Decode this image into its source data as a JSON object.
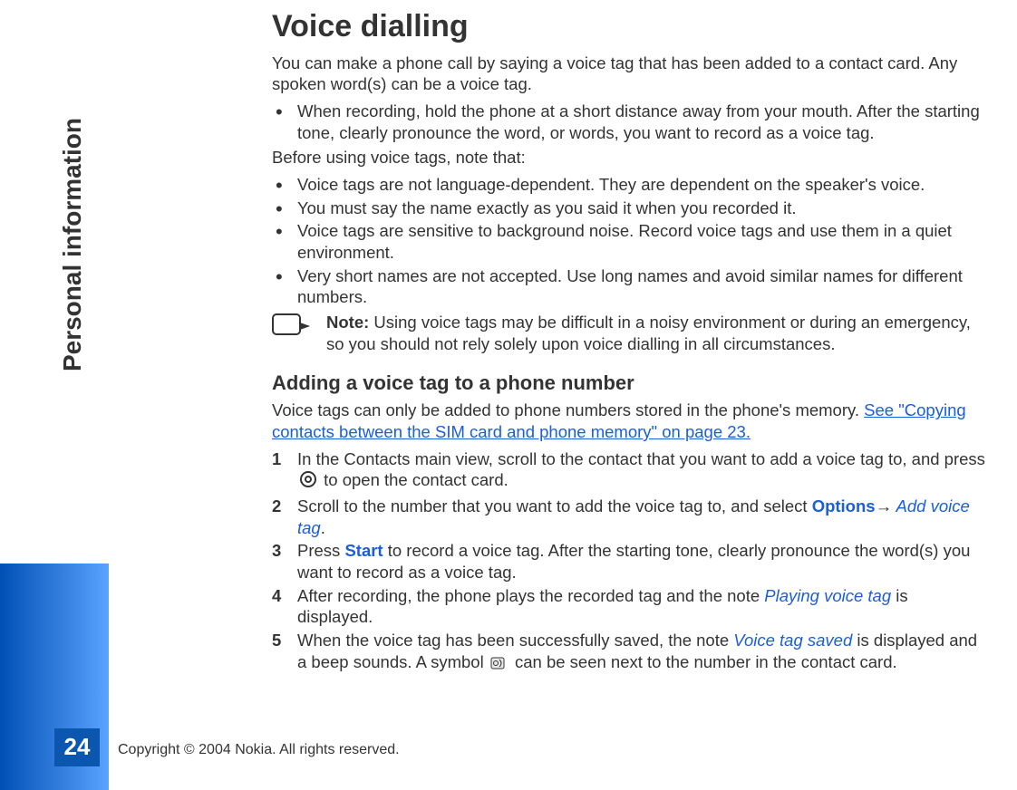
{
  "page": {
    "number": "24",
    "side_label": "Personal information",
    "footer": "Copyright © 2004 Nokia. All rights reserved."
  },
  "main": {
    "h1": "Voice dialling",
    "intro": "You can make a phone call by saying a voice tag that has been added to a contact card. Any spoken word(s) can be a voice tag.",
    "bullet_recording": "When recording, hold the phone at a short distance away from your mouth. After the starting tone, clearly pronounce the word, or words, you want to record as a voice tag.",
    "before_heading": "Before using voice tags, note that:",
    "bullets": [
      "Voice tags are not language-dependent. They are dependent on the speaker's voice.",
      "You must say the name exactly as you said it when you recorded it.",
      "Voice tags are sensitive to background noise. Record voice tags and use them in a quiet environment.",
      "Very short names are not accepted. Use long names and avoid similar names for different numbers."
    ],
    "note_label": "Note:",
    "note_body": " Using voice tags may be difficult in a noisy environment or during an emergency, so you should not rely solely upon voice dialling in all circumstances.",
    "h2": "Adding a voice tag to a phone number",
    "adding_intro_pre": "Voice tags can only be added to phone numbers stored in the phone's memory. ",
    "adding_link": "See \"Copying contacts between the SIM card and phone memory\" on page 23.",
    "steps": [
      {
        "num": "1",
        "pre": "In the Contacts main view, scroll to the contact that you want to add a voice tag to, and press ",
        "post": " to open the contact card."
      },
      {
        "num": "2",
        "pre": "Scroll to the number that you want to add the voice tag to, and select ",
        "ui_options": "Options",
        "arrow": "→",
        "ui_add": " Add voice tag",
        "post": "."
      },
      {
        "num": "3",
        "pre": "Press ",
        "ui_start": "Start",
        "post": " to record a voice tag. After the starting tone, clearly pronounce the word(s) you want to record as a voice tag."
      },
      {
        "num": "4",
        "pre": "After recording, the phone plays the recorded tag and the note ",
        "ui_playing": "Playing voice tag",
        "post": " is displayed."
      },
      {
        "num": "5",
        "pre": "When the voice tag has been successfully saved, the note ",
        "ui_saved": "Voice tag saved",
        "mid": " is displayed and a beep sounds. A symbol ",
        "post": " can be seen next to the number in the contact card."
      }
    ]
  }
}
